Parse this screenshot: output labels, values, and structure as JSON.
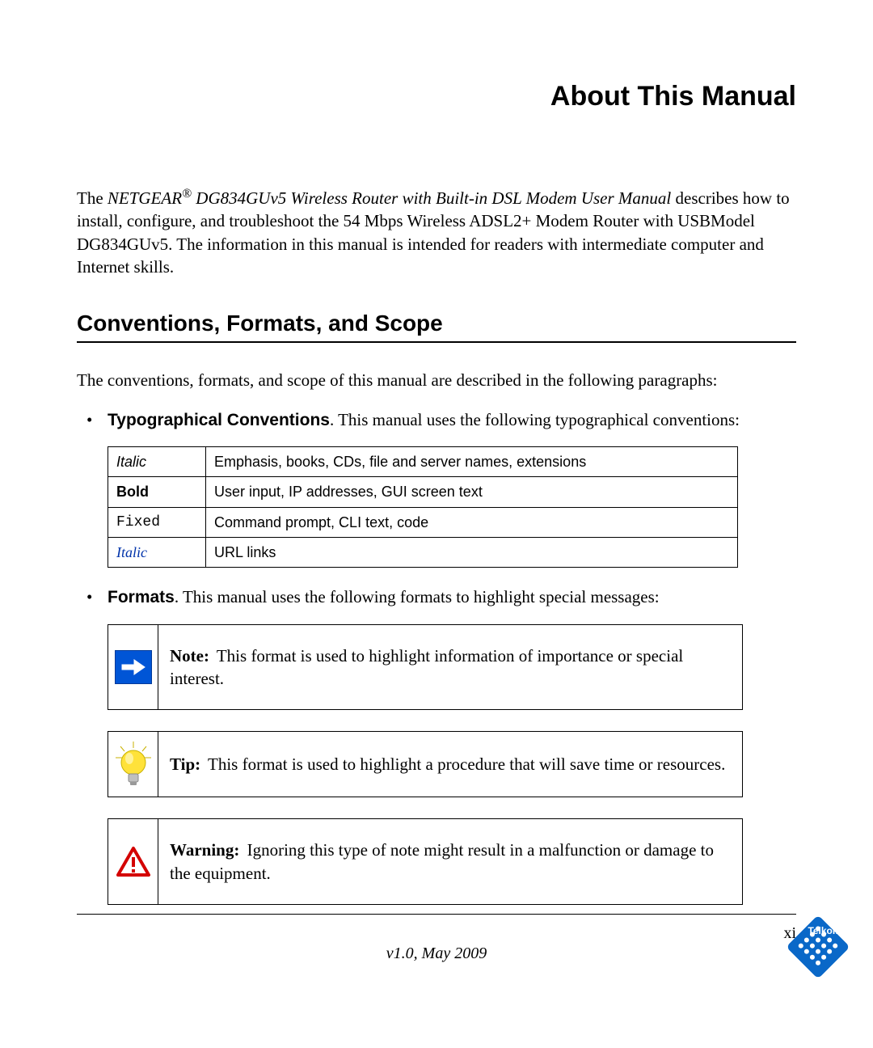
{
  "title": "About This Manual",
  "intro": {
    "pre": "The ",
    "product_before": "NETGEAR",
    "reg_mark": "®",
    "product_after": " DG834GUv5 Wireless Router with Built-in DSL Modem User Manual",
    "post": " describes how to install, configure, and troubleshoot the 54 Mbps Wireless ADSL2+ Modem Router with USBModel DG834GUv5. The information in this manual is intended for readers with intermediate computer and Internet skills."
  },
  "section_heading": "Conventions, Formats, and Scope",
  "lead_paragraph": "The conventions, formats, and scope of this manual are described in the following paragraphs:",
  "bullets": {
    "typo": {
      "lead_bold": "Typographical Conventions",
      "rest": ". This manual uses the following typographical conventions:"
    },
    "formats": {
      "lead_bold": "Formats",
      "rest": ". This manual uses the following formats to highlight special messages:"
    }
  },
  "conv_table": [
    {
      "label": "Italic",
      "style": "style-italic",
      "desc": "Emphasis, books, CDs, file and server names, extensions"
    },
    {
      "label": "Bold",
      "style": "style-bold",
      "desc": "User input, IP addresses, GUI screen text"
    },
    {
      "label": "Fixed",
      "style": "style-fixed",
      "desc": "Command prompt, CLI text, code"
    },
    {
      "label": "Italic",
      "style": "style-link",
      "desc": "URL links"
    }
  ],
  "callouts": {
    "note": {
      "label": "Note:",
      "text": " This format is used to highlight information of importance or special interest."
    },
    "tip": {
      "label": "Tip:",
      "text": " This format is used to highlight a procedure that will save time or resources."
    },
    "warning": {
      "label": "Warning:",
      "text": " Ignoring this type of note might result in a malfunction or damage to the equipment."
    }
  },
  "footer": {
    "page_number": "xi",
    "version": "v1.0, May 2009",
    "logo_text": "Telkom"
  }
}
